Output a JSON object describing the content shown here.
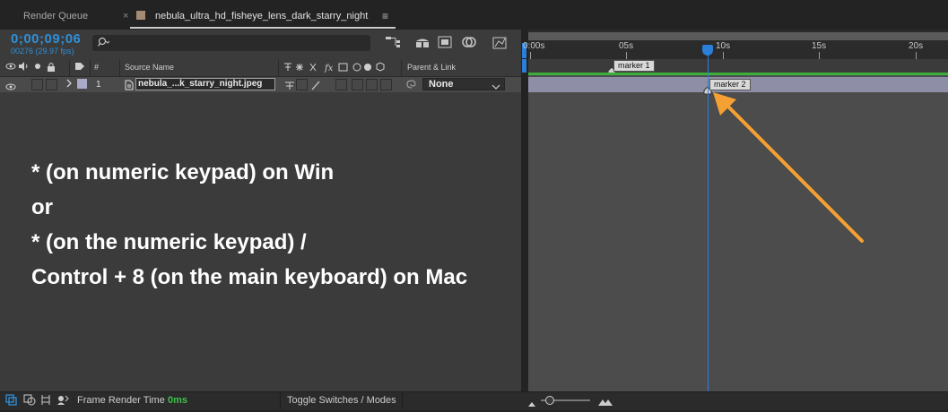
{
  "tabs": {
    "render_queue": "Render Queue",
    "close_glyph": "×",
    "comp_title": "nebula_ultra_hd_fisheye_lens_dark_starry_night",
    "menu_glyph": "≡"
  },
  "header": {
    "timecode": "0;00;09;06",
    "fps": "00276 (29.97 fps)"
  },
  "columns": {
    "source_name": "Source Name",
    "parent_link": "Parent & Link",
    "number": "#"
  },
  "layer": {
    "number": "1",
    "name": "nebula_...k_starry_night.jpeg",
    "parent": "None"
  },
  "ruler": {
    "ticks": [
      "0:00s",
      "05s",
      "10s",
      "15s",
      "20s"
    ]
  },
  "markers": {
    "m1": "marker 1",
    "m2": "marker 2"
  },
  "bottom": {
    "frame_render_label": "Frame Render Time",
    "frame_render_value": "0ms",
    "toggle": "Toggle Switches / Modes"
  },
  "overlay": {
    "line1": "* (on numeric keypad) on Win",
    "line2": "or",
    "line3": "* (on the numeric keypad) /",
    "line4": "Control + 8 (on the main keyboard) on Mac"
  },
  "colors": {
    "accent": "#2f8fd8",
    "layer_bar": "#8e8ea6",
    "label_green": "#3cae3c",
    "arrow": "#f5a033"
  }
}
